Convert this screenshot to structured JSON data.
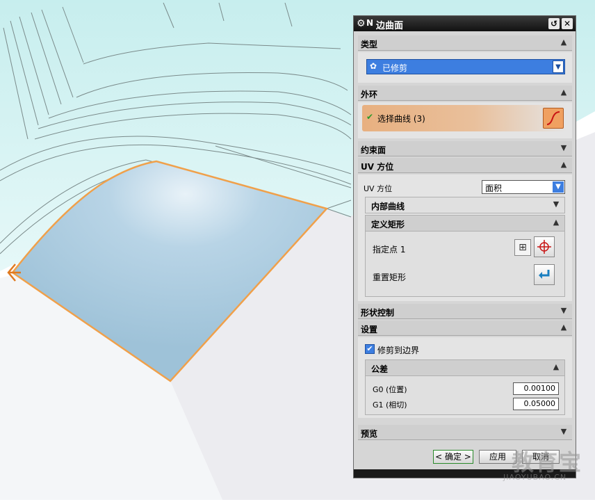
{
  "dialog": {
    "title": "边曲面",
    "sections": {
      "type": {
        "label": "类型",
        "selected": "已修剪"
      },
      "outer_loop": {
        "label": "外环",
        "select_curve": "选择曲线 (3)"
      },
      "constraint_face": {
        "label": "约束面"
      },
      "uv_orientation": {
        "label": "UV 方位",
        "field_label": "UV 方位",
        "field_value": "面积",
        "inner_curves": "内部曲线",
        "define_rect": {
          "label": "定义矩形",
          "specify_point": "指定点 1",
          "reset_rect": "重置矩形"
        }
      },
      "shape_control": {
        "label": "形状控制"
      },
      "settings": {
        "label": "设置",
        "trim_checkbox": "修剪到边界",
        "tolerance": {
          "label": "公差",
          "g0_label": "G0 (位置)",
          "g0_value": "0.00100",
          "g1_label": "G1 (相切)",
          "g1_value": "0.05000"
        }
      },
      "preview": {
        "label": "预览"
      }
    },
    "buttons": {
      "ok": "< 确定 >",
      "apply": "应用",
      "cancel": "取消"
    }
  },
  "colors": {
    "accent_blue": "#3d7ee0",
    "curve_orange": "#f0a04a",
    "surface_fill": "#a9cbe0",
    "model_cyan": "#dcf5f5"
  },
  "watermark": {
    "text": "教育宝",
    "url_text": "JIAOYUBAO.CN"
  }
}
